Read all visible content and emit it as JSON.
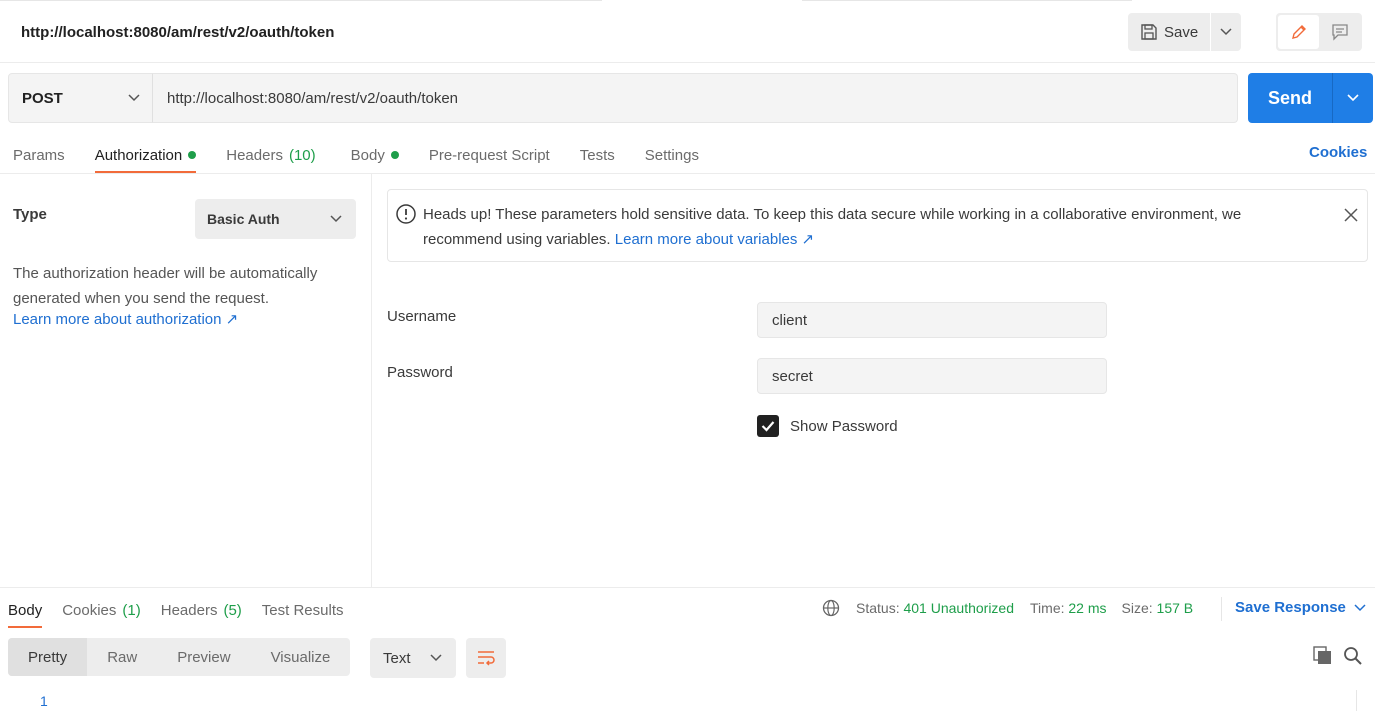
{
  "request_title": "http://localhost:8080/am/rest/v2/oauth/token",
  "toolbar": {
    "save_label": "Save"
  },
  "request": {
    "method": "POST",
    "url": "http://localhost:8080/am/rest/v2/oauth/token",
    "send_label": "Send"
  },
  "request_tabs": [
    {
      "label": "Params",
      "active": false
    },
    {
      "label": "Authorization",
      "active": true,
      "dot": true
    },
    {
      "label": "Headers",
      "count": "(10)",
      "active": false
    },
    {
      "label": "Body",
      "active": false,
      "dot": true
    },
    {
      "label": "Pre-request Script",
      "active": false
    },
    {
      "label": "Tests",
      "active": false
    },
    {
      "label": "Settings",
      "active": false
    }
  ],
  "cookies_link": "Cookies",
  "auth": {
    "type_label": "Type",
    "type_value": "Basic Auth",
    "description": "The authorization header will be automatically generated when you send the request.",
    "learn_more": "Learn more about authorization ↗",
    "warning_text": "Heads up! These parameters hold sensitive data. To keep this data secure while working in a collaborative environment, we recommend using variables.",
    "warning_link": "Learn more about variables ↗",
    "username_label": "Username",
    "username_value": "client",
    "password_label": "Password",
    "password_value": "secret",
    "show_password_label": "Show Password",
    "show_password_checked": true
  },
  "response": {
    "tabs": [
      {
        "label": "Body",
        "active": true
      },
      {
        "label": "Cookies",
        "count": "(1)"
      },
      {
        "label": "Headers",
        "count": "(5)"
      },
      {
        "label": "Test Results"
      }
    ],
    "status_label": "Status:",
    "status_value": "401 Unauthorized",
    "time_label": "Time:",
    "time_value": "22 ms",
    "size_label": "Size:",
    "size_value": "157 B",
    "save_response": "Save Response",
    "formats": [
      "Pretty",
      "Raw",
      "Preview",
      "Visualize"
    ],
    "format_active": "Pretty",
    "language": "Text",
    "line_number": "1"
  }
}
